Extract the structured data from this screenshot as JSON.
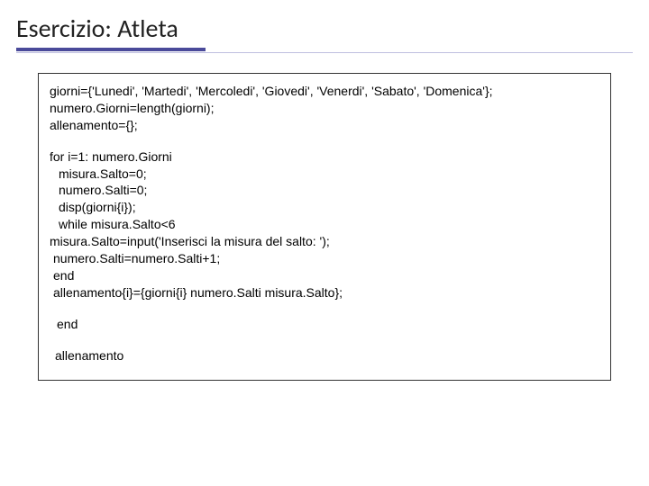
{
  "title": "Esercizio: Atleta",
  "code": {
    "l1": "giorni={'Lunedi', 'Martedi', 'Mercoledi', 'Giovedi', 'Venerdi', 'Sabato', 'Domenica'};",
    "l2": "numero.Giorni=length(giorni);",
    "l3": "allenamento={};",
    "l4": "for i=1: numero.Giorni",
    "l5": "misura.Salto=0;",
    "l6": "numero.Salti=0;",
    "l7": "disp(giorni{i});",
    "l8": "while misura.Salto<6",
    "l9": "misura.Salto=input('Inserisci la misura del salto: ');",
    "l10": "numero.Salti=numero.Salti+1;",
    "l11": "end",
    "l12": "allenamento{i}={giorni{i} numero.Salti misura.Salto};",
    "l13": "end",
    "l14": "allenamento"
  }
}
